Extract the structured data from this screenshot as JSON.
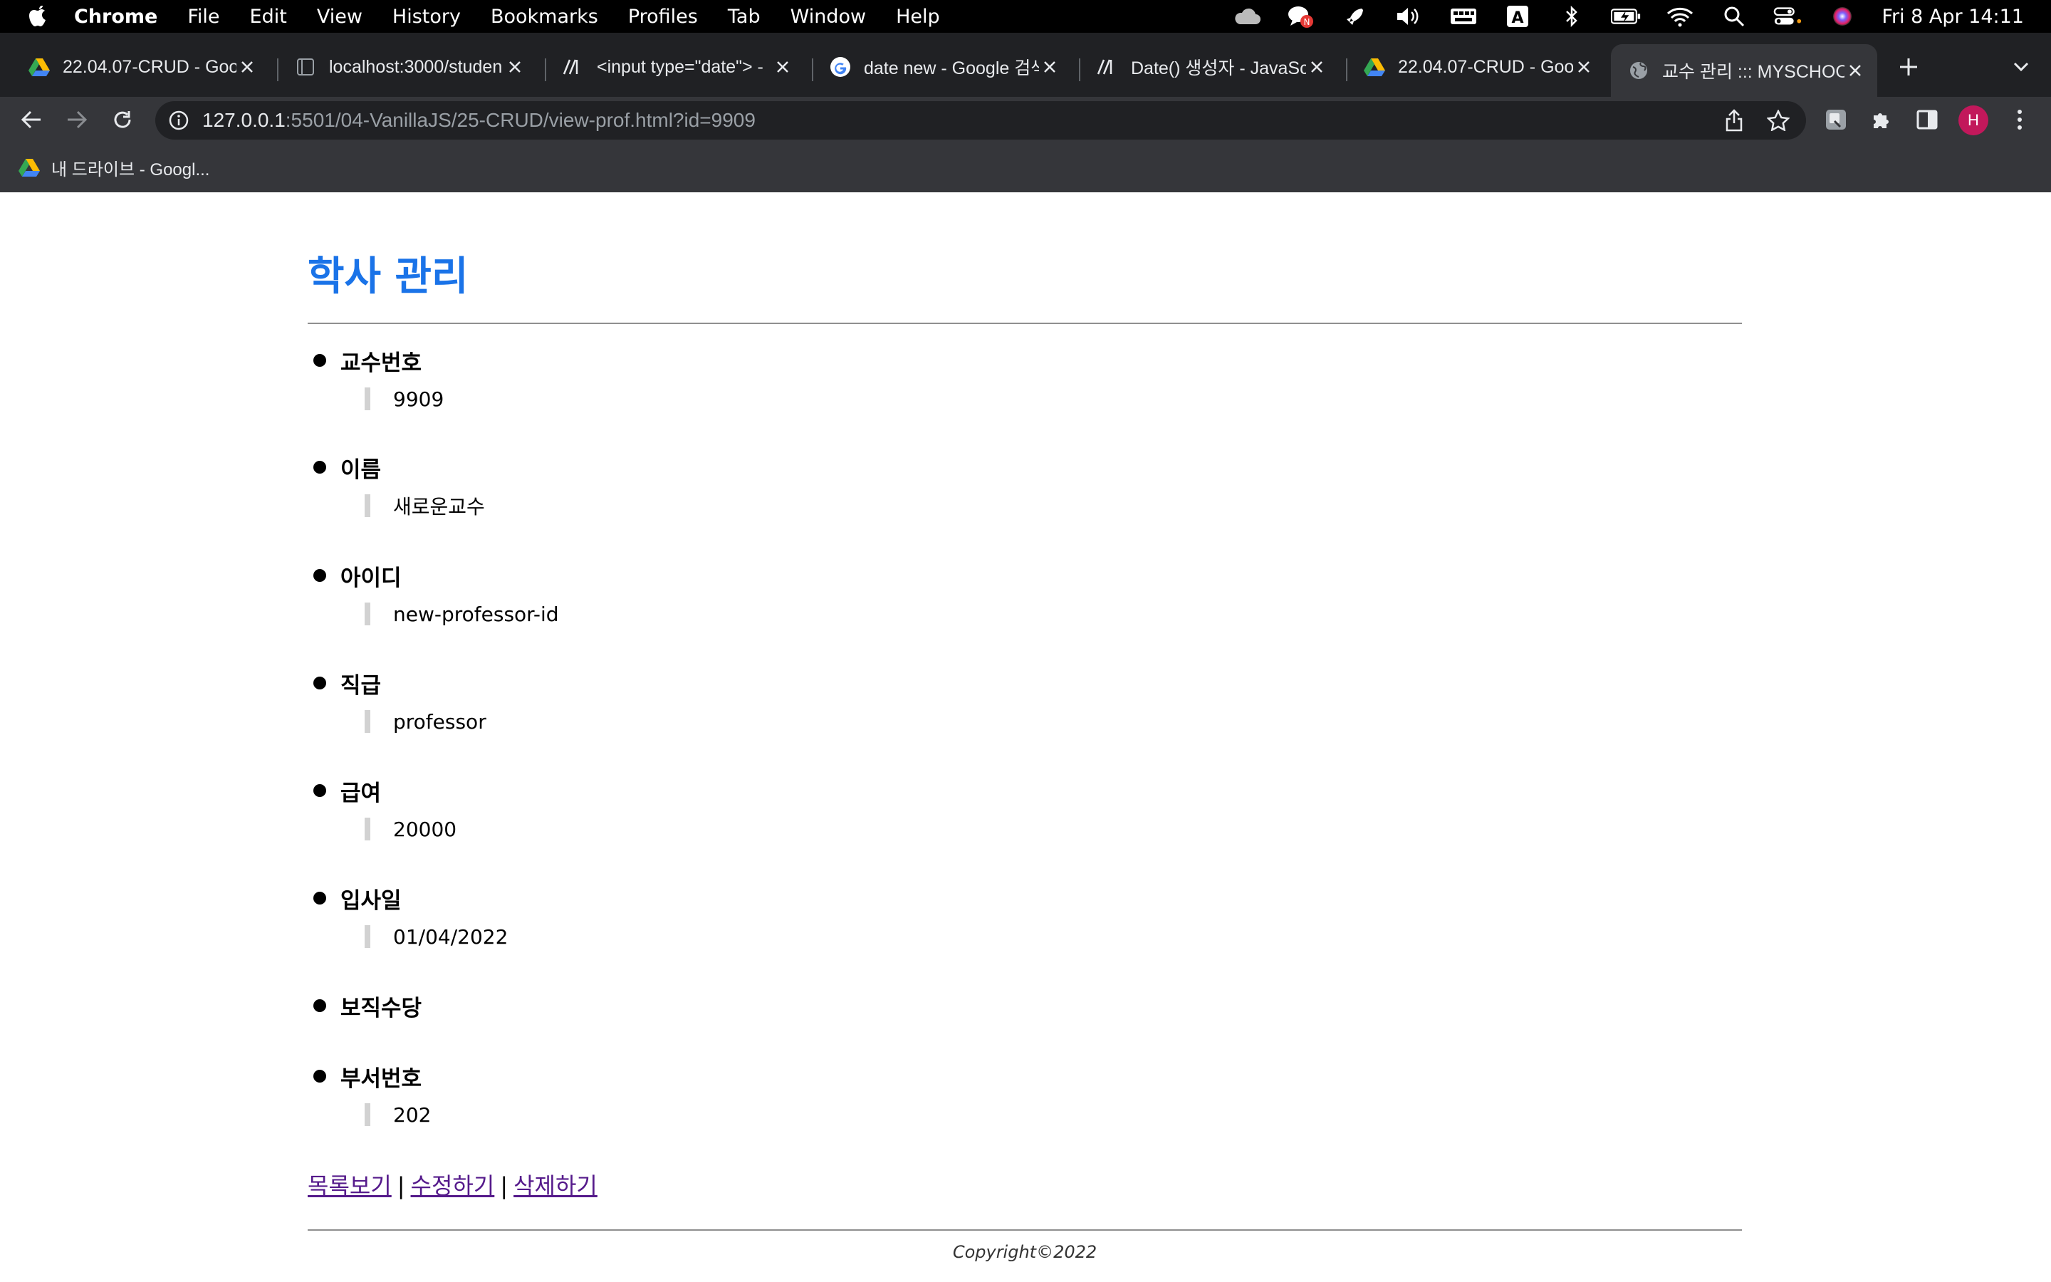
{
  "menubar": {
    "app_name": "Chrome",
    "items": [
      "File",
      "Edit",
      "View",
      "History",
      "Bookmarks",
      "Profiles",
      "Tab",
      "Window",
      "Help"
    ],
    "datetime": "Fri 8 Apr  14:11",
    "status_icons": [
      "cloud-icon",
      "chat-icon",
      "rocket-icon",
      "volume-icon",
      "keyboard-icon",
      "input-source-icon",
      "bluetooth-icon",
      "battery-icon",
      "wifi-icon",
      "spotlight-icon",
      "control-center-icon",
      "siri-icon"
    ]
  },
  "tabs": [
    {
      "title": "22.04.07-CRUD - Goo",
      "icon": "google-drive-icon"
    },
    {
      "title": "localhost:3000/studen",
      "icon": "blank-page-icon"
    },
    {
      "title": "<input type=\"date\"> -",
      "icon": "mdn-icon"
    },
    {
      "title": "date new - Google 검색",
      "icon": "google-icon"
    },
    {
      "title": "Date() 생성자 - JavaSc",
      "icon": "mdn-icon"
    },
    {
      "title": "22.04.07-CRUD - Goo",
      "icon": "google-drive-icon"
    },
    {
      "title": "교수 관리 ::: MYSCHOOL",
      "icon": "globe-icon",
      "active": true
    }
  ],
  "omnibox": {
    "url_host": "127.0.0.1",
    "url_rest": ":5501/04-VanillaJS/25-CRUD/view-prof.html?id=9909"
  },
  "profile": {
    "initial": "H",
    "color": "#c2185b"
  },
  "bookmarks": [
    {
      "label": "내 드라이브 - Googl...",
      "icon": "google-drive-icon"
    }
  ],
  "page": {
    "title": "학사 관리",
    "title_color": "#1a73e8",
    "fields": [
      {
        "label": "교수번호",
        "value": "9909"
      },
      {
        "label": "이름",
        "value": "새로운교수"
      },
      {
        "label": "아이디",
        "value": "new-professor-id"
      },
      {
        "label": "직급",
        "value": "professor"
      },
      {
        "label": "급여",
        "value": "20000"
      },
      {
        "label": "입사일",
        "value": "01/04/2022"
      },
      {
        "label": "보직수당",
        "value": ""
      },
      {
        "label": "부서번호",
        "value": "202"
      }
    ],
    "links": {
      "list": "목록보기",
      "edit": "수정하기",
      "delete": "삭제하기",
      "separator": "|"
    },
    "footer": "Copyright©2022"
  }
}
